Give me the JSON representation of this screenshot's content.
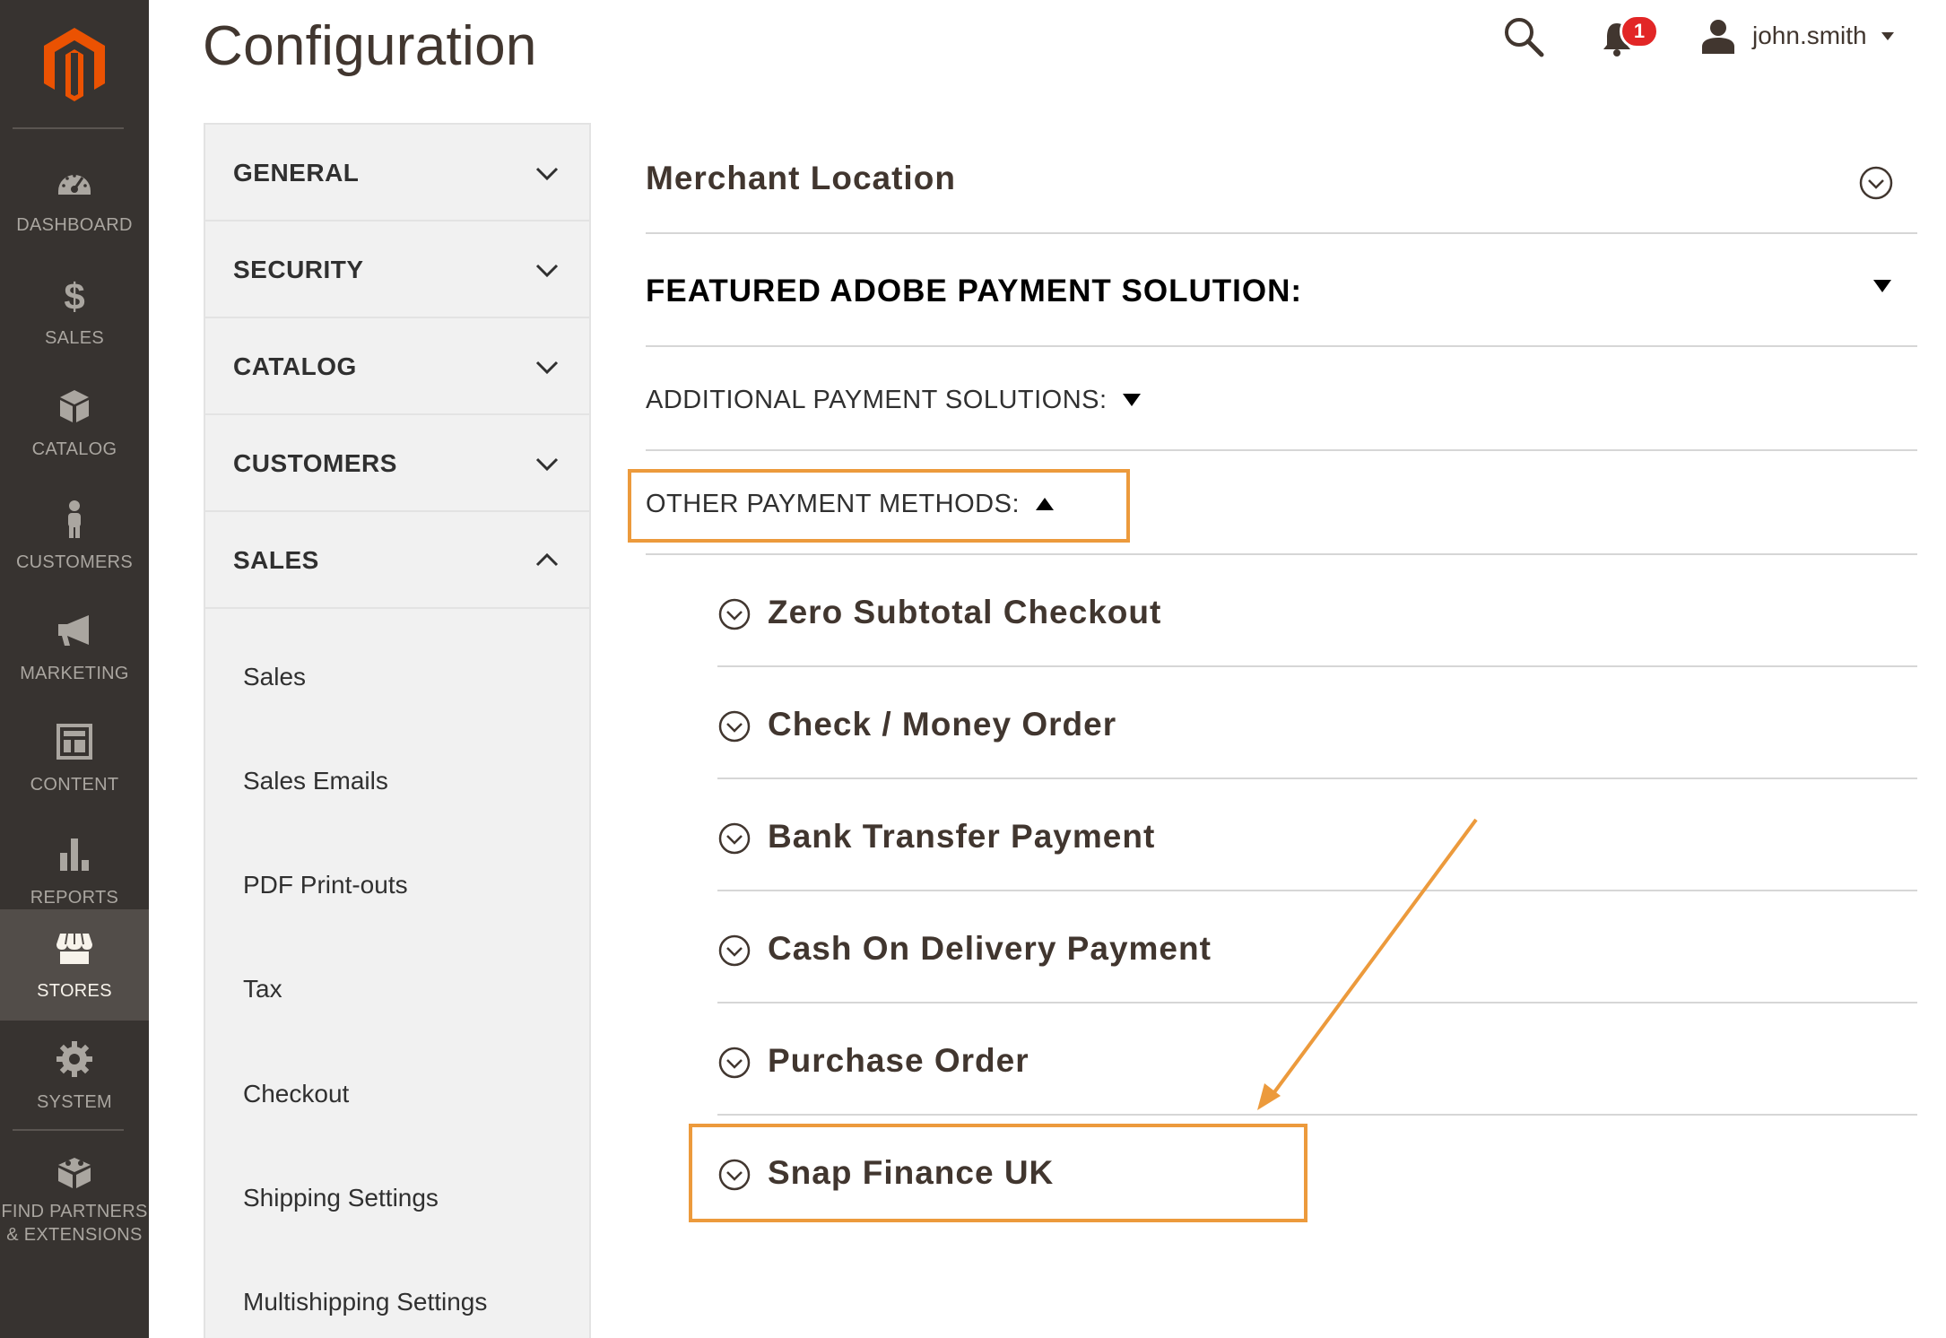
{
  "nav": {
    "items": [
      {
        "label": "DASHBOARD",
        "icon": "dashboard-icon"
      },
      {
        "label": "SALES",
        "icon": "dollar-icon"
      },
      {
        "label": "CATALOG",
        "icon": "box-icon"
      },
      {
        "label": "CUSTOMERS",
        "icon": "person-icon"
      },
      {
        "label": "MARKETING",
        "icon": "megaphone-icon"
      },
      {
        "label": "CONTENT",
        "icon": "layout-icon"
      },
      {
        "label": "REPORTS",
        "icon": "bar-chart-icon"
      },
      {
        "label": "STORES",
        "icon": "storefront-icon",
        "active": true
      },
      {
        "label": "SYSTEM",
        "icon": "gear-icon"
      },
      {
        "label_line1": "FIND PARTNERS",
        "label_line2": "& EXTENSIONS",
        "icon": "blocks-icon"
      }
    ]
  },
  "header": {
    "title": "Configuration",
    "notification_count": "1",
    "username": "john.smith"
  },
  "config_tabs": {
    "sections": [
      {
        "label": "GENERAL",
        "expanded": false
      },
      {
        "label": "SECURITY",
        "expanded": false
      },
      {
        "label": "CATALOG",
        "expanded": false
      },
      {
        "label": "CUSTOMERS",
        "expanded": false
      },
      {
        "label": "SALES",
        "expanded": true
      }
    ],
    "sales_links": [
      "Sales",
      "Sales Emails",
      "PDF Print-outs",
      "Tax",
      "Checkout",
      "Shipping Settings",
      "Multishipping Settings"
    ]
  },
  "main": {
    "merchant_location": "Merchant Location",
    "featured": "FEATURED ADOBE PAYMENT SOLUTION:",
    "additional": "ADDITIONAL PAYMENT SOLUTIONS:",
    "other": "OTHER PAYMENT METHODS:",
    "methods": [
      "Zero Subtotal Checkout",
      "Check / Money Order",
      "Bank Transfer Payment",
      "Cash On Delivery Payment",
      "Purchase Order",
      "Snap Finance UK"
    ]
  },
  "colors": {
    "nav_bg": "#373330",
    "nav_active_bg": "#524d49",
    "brand_orange": "#eb5202",
    "highlight_orange": "#ec9a3c",
    "badge_red": "#e22626"
  }
}
